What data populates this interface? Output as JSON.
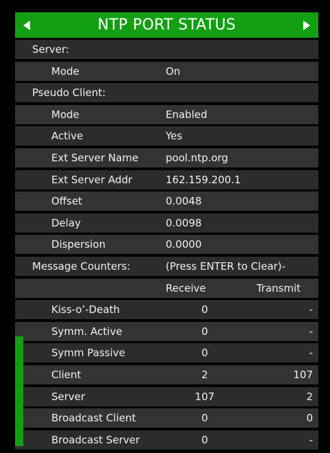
{
  "header": {
    "title": "NTP PORT STATUS",
    "left_arrow_icon": "arrow-left-icon",
    "right_arrow_icon": "arrow-right-icon",
    "accent_color": "#12a012"
  },
  "server": {
    "section_label": "Server:",
    "mode_label": "Mode",
    "mode_value": "On"
  },
  "pseudo_client": {
    "section_label": "Pseudo Client:",
    "rows": [
      {
        "label": "Mode",
        "value": "Enabled"
      },
      {
        "label": "Active",
        "value": "Yes"
      },
      {
        "label": "Ext Server Name",
        "value": "pool.ntp.org"
      },
      {
        "label": "Ext Server Addr",
        "value": "162.159.200.1"
      },
      {
        "label": "Offset",
        "value": "0.0048"
      },
      {
        "label": "Delay",
        "value": "0.0098"
      },
      {
        "label": "Dispersion",
        "value": "0.0000"
      }
    ]
  },
  "counters": {
    "section_label": "Message Counters:",
    "hint": "(Press ENTER to Clear)-",
    "receive_header": "Receive",
    "transmit_header": "Transmit",
    "rows": [
      {
        "label": "Kiss-o’-Death",
        "receive": "0",
        "transmit": "-"
      },
      {
        "label": "Symm. Active",
        "receive": "0",
        "transmit": "-"
      },
      {
        "label": "Symm Passive",
        "receive": "0",
        "transmit": "-"
      },
      {
        "label": "Client",
        "receive": "2",
        "transmit": "107"
      },
      {
        "label": "Server",
        "receive": "107",
        "transmit": "2"
      },
      {
        "label": "Broadcast Client",
        "receive": "0",
        "transmit": "0"
      },
      {
        "label": "Broadcast Server",
        "receive": "0",
        "transmit": "-"
      }
    ]
  }
}
